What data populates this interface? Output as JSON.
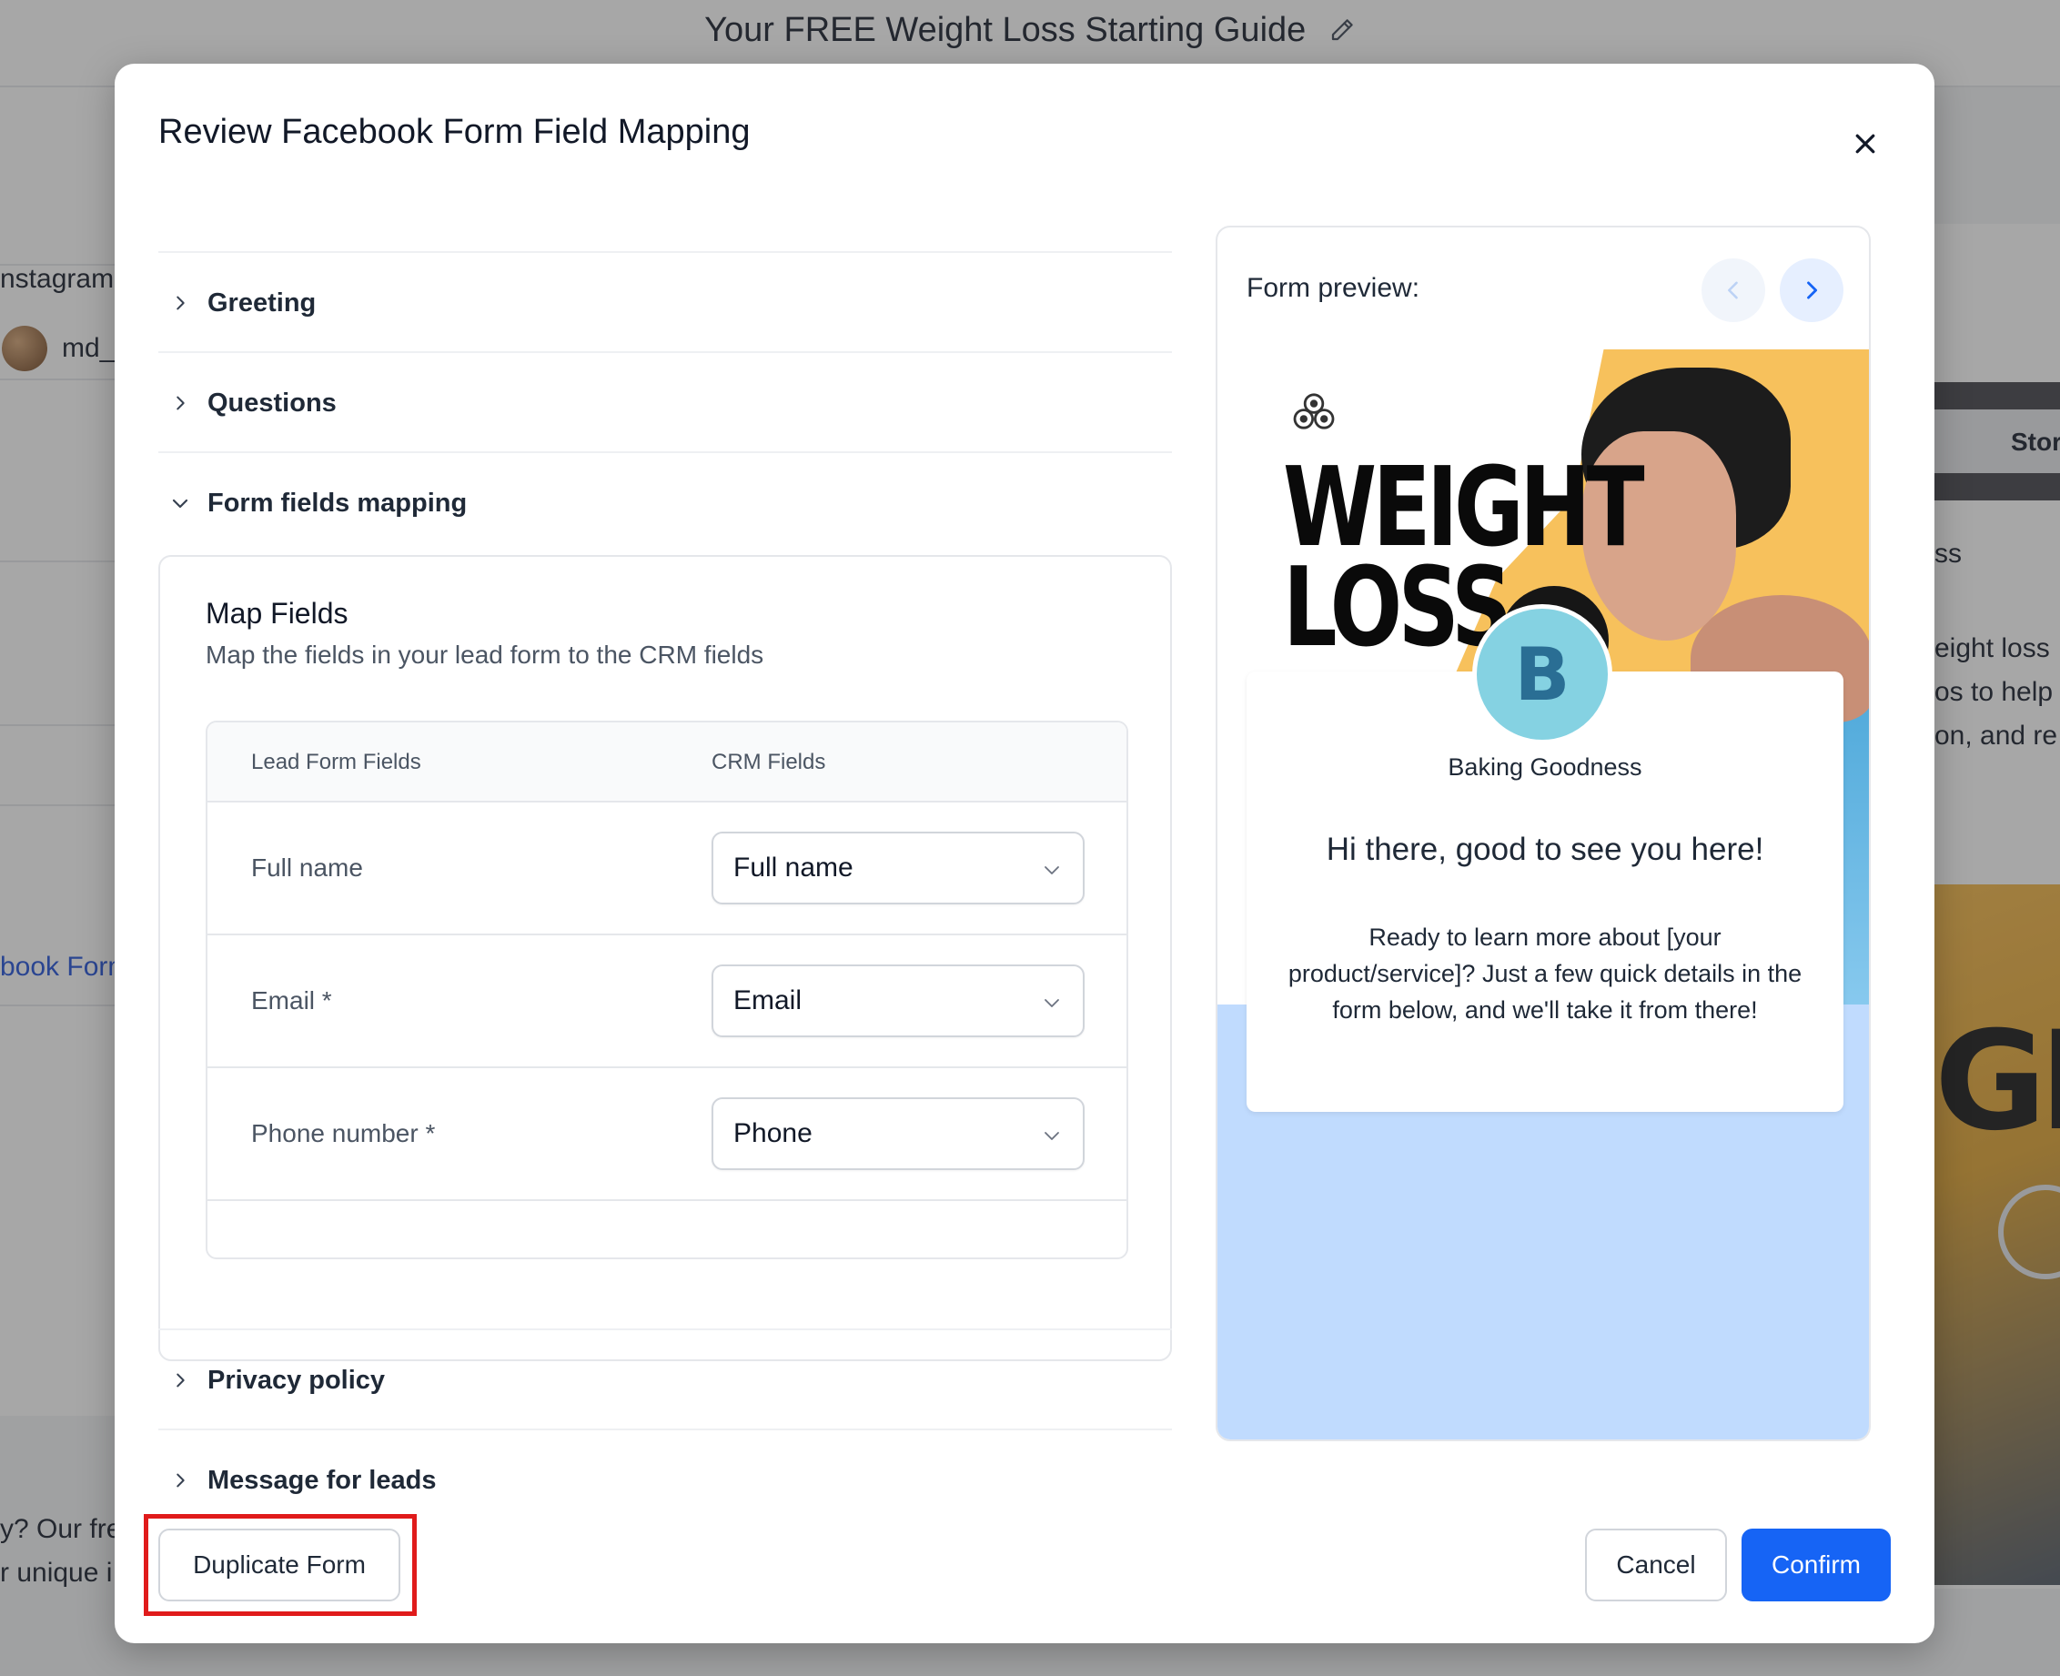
{
  "background": {
    "page_title": "Your FREE Weight Loss Starting Guide",
    "left_fragments": [
      "nstagram A",
      "md_g",
      "book Form",
      "y? Our fre",
      "r unique i"
    ],
    "right_fragments": [
      "Stor",
      "ss",
      "eight loss",
      "os to help",
      "on, and re"
    ],
    "ad_text": "GHT"
  },
  "modal": {
    "title": "Review Facebook Form Field Mapping",
    "sections": {
      "greeting": "Greeting",
      "questions": "Questions",
      "form_fields_mapping": "Form fields mapping",
      "privacy_policy": "Privacy policy",
      "message_for_leads": "Message for leads"
    },
    "map_fields": {
      "title": "Map Fields",
      "subtitle": "Map the fields in your lead form to the CRM fields",
      "columns": [
        "Lead Form Fields",
        "CRM Fields"
      ],
      "rows": [
        {
          "lead_field": "Full name",
          "crm_field": "Full name"
        },
        {
          "lead_field": "Email *",
          "crm_field": "Email"
        },
        {
          "lead_field": "Phone number *",
          "crm_field": "Phone"
        }
      ]
    },
    "preview": {
      "label": "Form preview:",
      "hero_line1": "WEIGHT",
      "hero_line2": "LOSS",
      "avatar_letter": "B",
      "brand_name": "Baking Goodness",
      "greeting": "Hi there, good to see you here!",
      "description": "Ready to learn more about [your product/service]? Just a few quick details in the form below, and we'll take it from there!"
    },
    "buttons": {
      "duplicate": "Duplicate Form",
      "cancel": "Cancel",
      "confirm": "Confirm"
    }
  },
  "colors": {
    "primary": "#1664f5",
    "highlight": "#e01b1b",
    "preview_blue": "#c0dbfe",
    "avatar": "#85d2e2",
    "splash": "#f7c15c"
  },
  "icons": [
    "pencil-icon",
    "close-icon",
    "chevron-right-icon",
    "chevron-down-icon",
    "chevron-left-icon",
    "dropdown-arrow-icon",
    "brand-logo-icon",
    "play-icon"
  ]
}
